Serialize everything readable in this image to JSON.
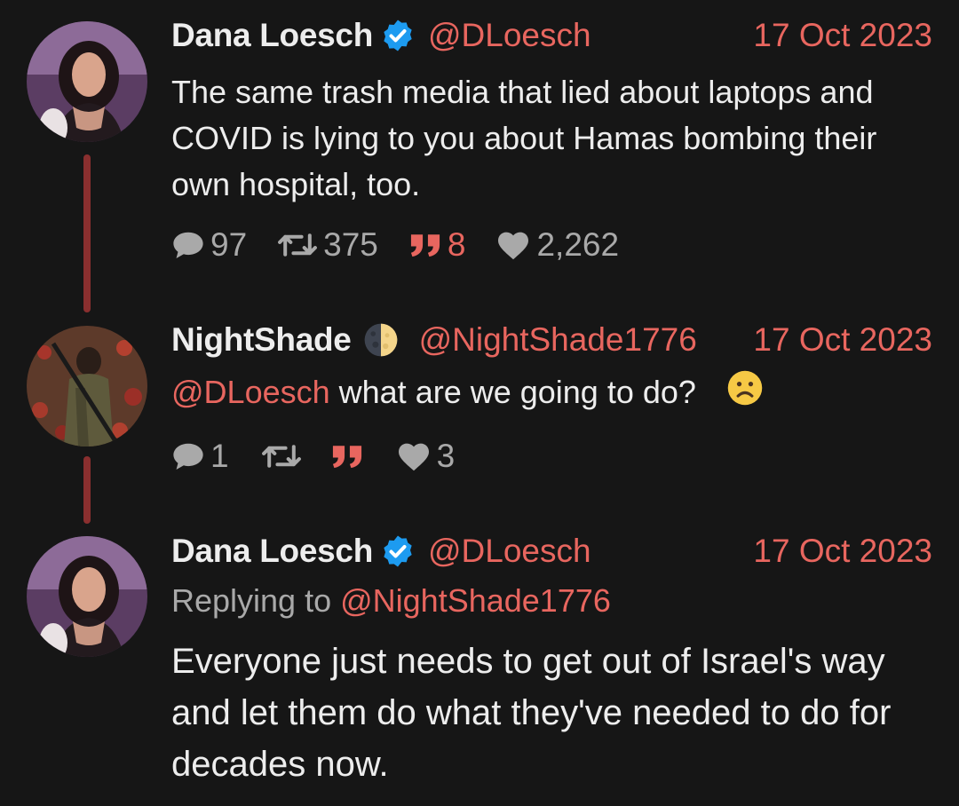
{
  "tweets": [
    {
      "name": "Dana Loesch",
      "verified": true,
      "handle": "@DLoesch",
      "date": "17 Oct 2023",
      "text": "The same trash media that lied about laptops and COVID is lying to you about Hamas bombing their own hospital, too.",
      "stats": {
        "replies": "97",
        "retweets": "375",
        "quotes": "8",
        "likes": "2,262"
      }
    },
    {
      "name": "NightShade",
      "emoji": "🌓",
      "handle": "@NightShade1776",
      "date": "17 Oct 2023",
      "mention": "@DLoesch",
      "text": " what are we going to do?",
      "stats": {
        "replies": "1",
        "retweets": "",
        "quotes": "",
        "likes": "3"
      }
    },
    {
      "name": "Dana Loesch",
      "verified": true,
      "handle": "@DLoesch",
      "date": "17 Oct 2023",
      "replying_prefix": "Replying to ",
      "replying_to": "@NightShade1776",
      "text": "Everyone just needs to get out of Israel's way and let them do what they've needed to do for decades now."
    }
  ],
  "colors": {
    "background": "#161616",
    "accent": "#e8665f",
    "thread_line": "#8a2f2f",
    "verified": "#1d9bf0",
    "muted": "#a9a9a9"
  },
  "icons": [
    "verified-badge-icon",
    "reply-icon",
    "retweet-icon",
    "quote-icon",
    "heart-icon",
    "frown-emoji-icon"
  ]
}
